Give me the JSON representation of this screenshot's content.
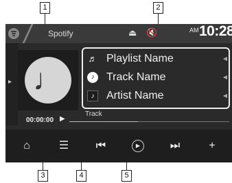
{
  "source": {
    "name": "Spotify",
    "icon": "spotify-logo-icon"
  },
  "status": {
    "eject_icon": "eject-icon",
    "mute_icon": "mute-icon"
  },
  "clock": {
    "ampm": "AM",
    "time": "10:28"
  },
  "track_info": [
    {
      "icon": "music-note-icon",
      "glyph": "♬",
      "label": "Playlist Name"
    },
    {
      "icon": "track-icon",
      "glyph": "♪",
      "label": "Track Name"
    },
    {
      "icon": "artist-icon",
      "glyph": "♪",
      "label": "Artist Name"
    }
  ],
  "playback": {
    "elapsed": "00:00:00",
    "progress_label": "Track",
    "progress_fraction": 0.43
  },
  "controls": [
    {
      "name": "home-button",
      "icon": "home-icon",
      "glyph": "⌂"
    },
    {
      "name": "menu-button",
      "icon": "menu-icon",
      "glyph": "☰"
    },
    {
      "name": "previous-button",
      "icon": "previous-track-icon",
      "glyph": "⏮"
    },
    {
      "name": "play-pause-button",
      "icon": "play-pause-icon",
      "glyph": "▶"
    },
    {
      "name": "next-button",
      "icon": "next-track-icon",
      "glyph": "⏭"
    },
    {
      "name": "add-button",
      "icon": "plus-icon",
      "glyph": "+"
    }
  ],
  "callouts": [
    "1",
    "2",
    "3",
    "4",
    "5"
  ]
}
